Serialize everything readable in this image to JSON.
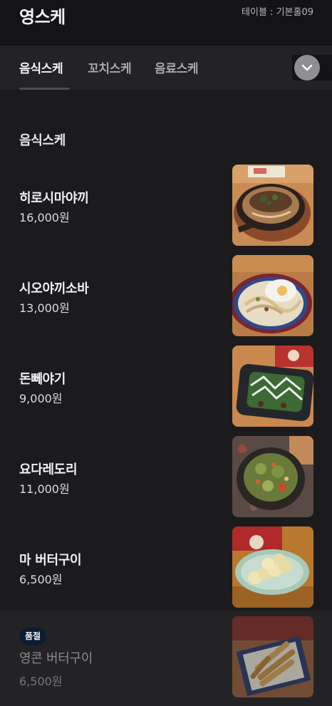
{
  "header": {
    "store_name": "영스케",
    "table_info": "테이블 : 기본홀09"
  },
  "tabs": [
    {
      "label": "음식스케",
      "active": true
    },
    {
      "label": "꼬치스케",
      "active": false
    },
    {
      "label": "음료스케",
      "active": false
    }
  ],
  "expand_icon": "chevron-down-icon",
  "section": {
    "title": "음식스케"
  },
  "items": [
    {
      "name": "히로시마야끼",
      "price": "16,000원",
      "sold_out": false
    },
    {
      "name": "시오야끼소바",
      "price": "13,000원",
      "sold_out": false
    },
    {
      "name": "돈뻬야기",
      "price": "9,000원",
      "sold_out": false
    },
    {
      "name": "요다레도리",
      "price": "11,000원",
      "sold_out": false
    },
    {
      "name": "마 버터구이",
      "price": "6,500원",
      "sold_out": false
    },
    {
      "name": "영콘 버터구이",
      "price": "6,500원",
      "sold_out": true,
      "badge": "품절"
    }
  ],
  "colors": {
    "background": "#141416",
    "tabbar": "#232326",
    "content": "#1b1b1d",
    "soldout_badge": "#0d1b33"
  }
}
